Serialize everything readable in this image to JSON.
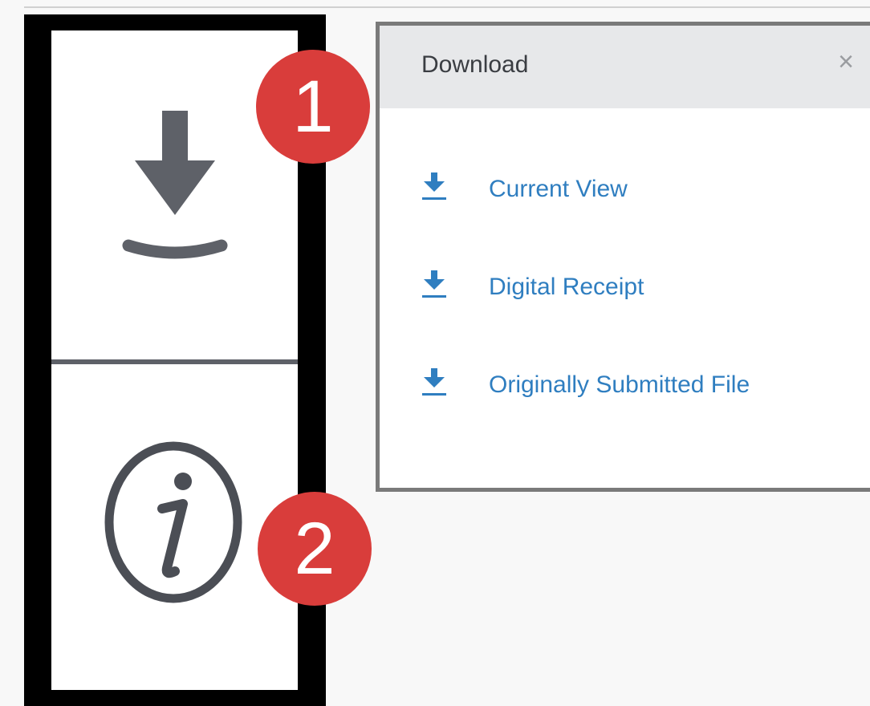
{
  "colors": {
    "link": "#2f7ec0",
    "badge": "#d93d3b",
    "icon_gray": "#5e6168",
    "header_bg": "#e7e8ea"
  },
  "toolbar": {
    "download_icon": "download-icon",
    "info_icon": "info-icon"
  },
  "badges": [
    "1",
    "2"
  ],
  "download_panel": {
    "title": "Download",
    "close_label": "×",
    "options": [
      {
        "label": "Current View",
        "icon": "download-icon"
      },
      {
        "label": "Digital Receipt",
        "icon": "download-icon"
      },
      {
        "label": "Originally Submitted File",
        "icon": "download-icon"
      }
    ]
  }
}
